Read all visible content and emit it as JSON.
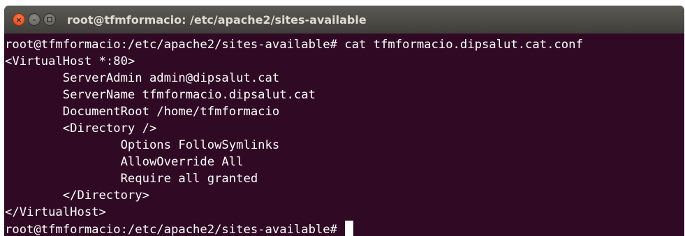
{
  "window": {
    "title": "root@tfmformacio: /etc/apache2/sites-available",
    "close_glyph": "×",
    "minimize_glyph": "–"
  },
  "terminal": {
    "lines": [
      "root@tfmformacio:/etc/apache2/sites-available# cat tfmformacio.dipsalut.cat.conf",
      "<VirtualHost *:80>",
      "        ServerAdmin admin@dipsalut.cat",
      "        ServerName tfmformacio.dipsalut.cat",
      "        DocumentRoot /home/tfmformacio",
      "        <Directory />",
      "                Options FollowSymlinks",
      "                AllowOverride All",
      "                Require all granted",
      "        </Directory>",
      "</VirtualHost>"
    ],
    "prompt": "root@tfmformacio:/etc/apache2/sites-available# "
  },
  "colors": {
    "terminal_bg": "#300a24",
    "terminal_fg": "#ffffff",
    "titlebar": "#4a4945",
    "close_button": "#dd4814"
  }
}
